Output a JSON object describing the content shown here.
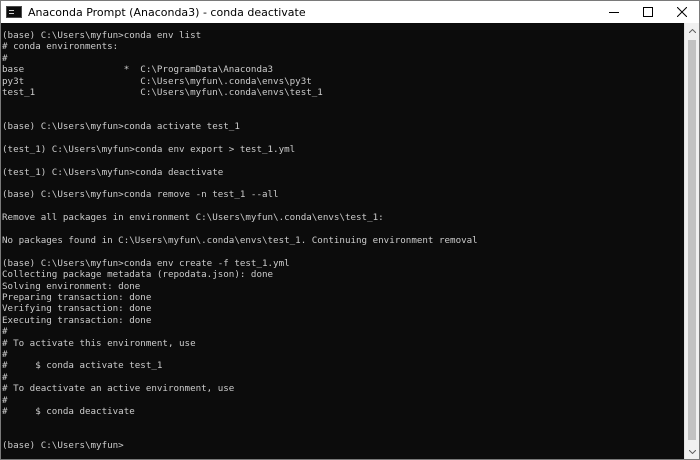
{
  "window": {
    "title": "Anaconda Prompt (Anaconda3) - conda  deactivate",
    "icon": "console-icon"
  },
  "controls": {
    "minimize": "minimize-icon",
    "maximize": "maximize-icon",
    "close": "close-icon"
  },
  "console": {
    "lines": [
      "(base) C:\\Users\\myfun>conda env list",
      "# conda environments:",
      "#",
      "base                  *  C:\\ProgramData\\Anaconda3",
      "py3t                     C:\\Users\\myfun\\.conda\\envs\\py3t",
      "test_1                   C:\\Users\\myfun\\.conda\\envs\\test_1",
      "",
      "",
      "(base) C:\\Users\\myfun>conda activate test_1",
      "",
      "(test_1) C:\\Users\\myfun>conda env export > test_1.yml",
      "",
      "(test_1) C:\\Users\\myfun>conda deactivate",
      "",
      "(base) C:\\Users\\myfun>conda remove -n test_1 --all",
      "",
      "Remove all packages in environment C:\\Users\\myfun\\.conda\\envs\\test_1:",
      "",
      "No packages found in C:\\Users\\myfun\\.conda\\envs\\test_1. Continuing environment removal",
      "",
      "(base) C:\\Users\\myfun>conda env create -f test_1.yml",
      "Collecting package metadata (repodata.json): done",
      "Solving environment: done",
      "Preparing transaction: done",
      "Verifying transaction: done",
      "Executing transaction: done",
      "#",
      "# To activate this environment, use",
      "#",
      "#     $ conda activate test_1",
      "#",
      "# To deactivate an active environment, use",
      "#",
      "#     $ conda deactivate",
      "",
      "",
      "(base) C:\\Users\\myfun>"
    ]
  },
  "scrollbar": {
    "up": "scroll-up-arrow-icon",
    "down": "scroll-down-arrow-icon"
  },
  "colors": {
    "console_background": "#0c0c0c",
    "console_text": "#cccccc",
    "titlebar_background": "#ffffff"
  }
}
